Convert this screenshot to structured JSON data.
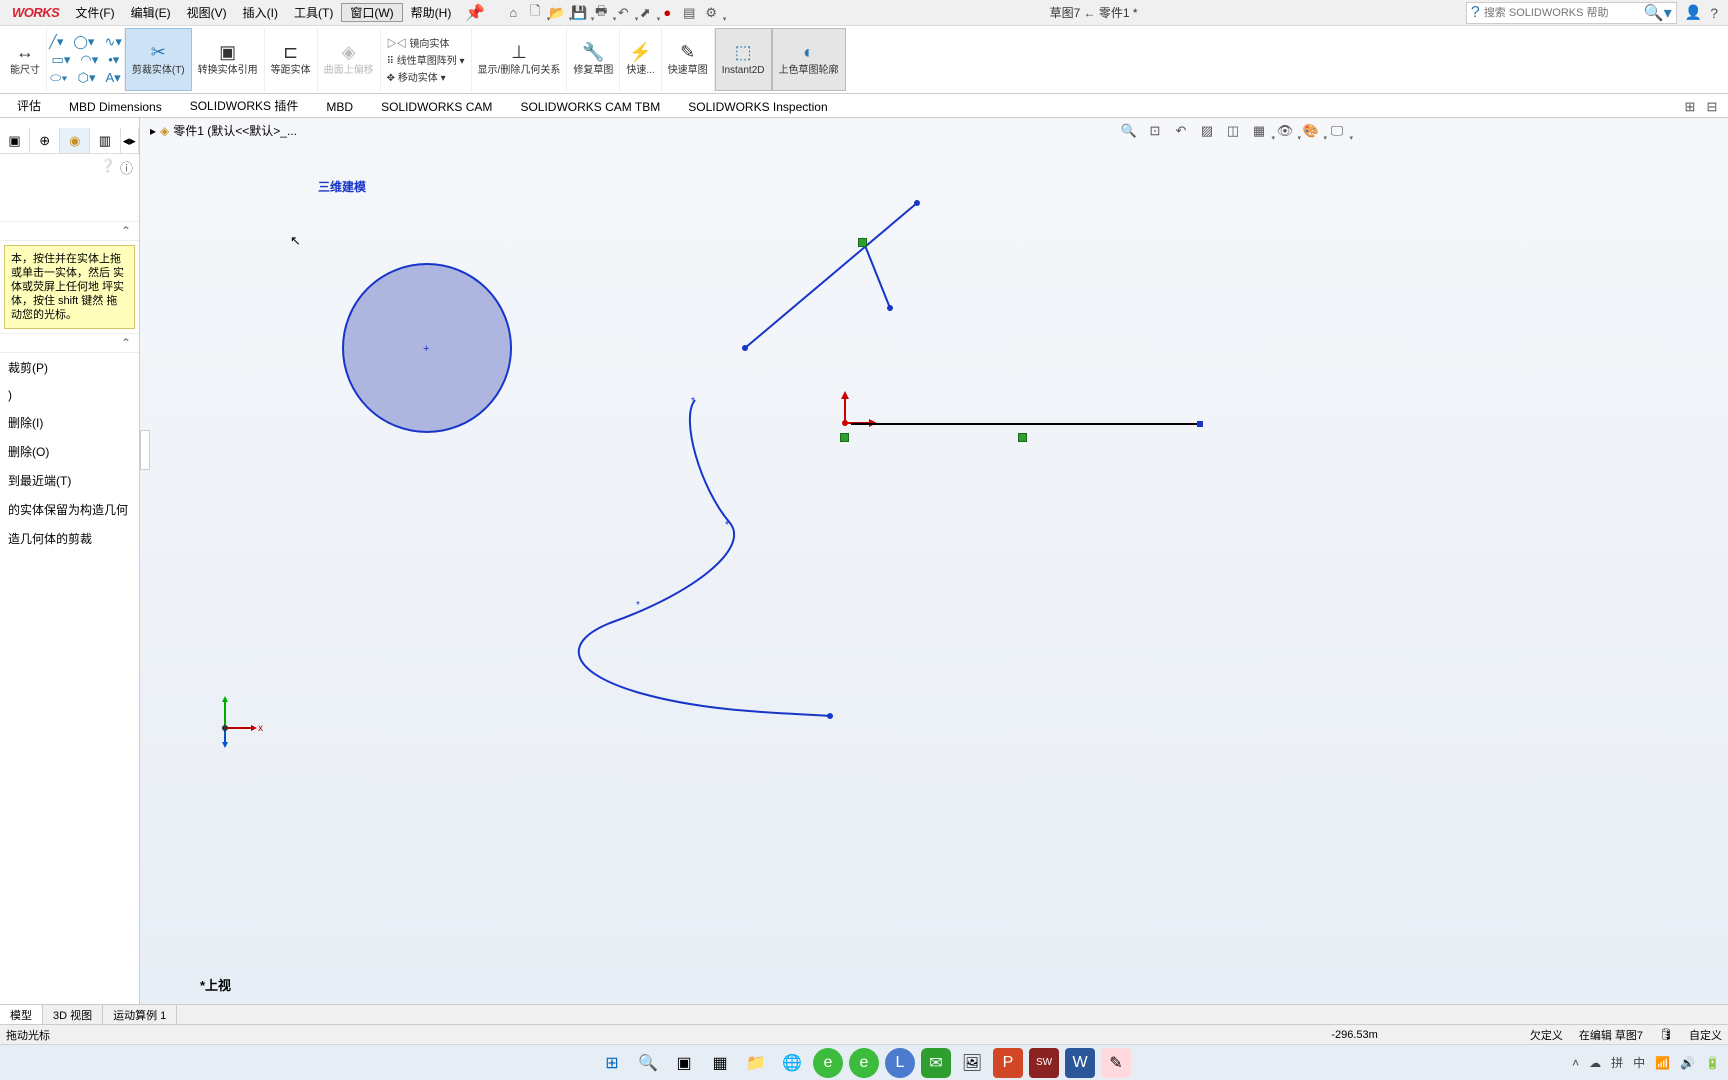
{
  "app": {
    "logo": "WORKS"
  },
  "menu": {
    "file": "文件(F)",
    "edit": "编辑(E)",
    "view": "视图(V)",
    "insert": "插入(I)",
    "tools": "工具(T)",
    "window": "窗口(W)",
    "help": "帮助(H)"
  },
  "doc_title": "草图7 ← 零件1 *",
  "search": {
    "placeholder": "搜索 SOLIDWORKS 帮助"
  },
  "ribbon": {
    "smart_dim": "能尺寸",
    "trim": "剪裁实体(T)",
    "convert": "转换实体引用",
    "offset": "等距实体",
    "surface_offset": "曲面上偏移",
    "mirror": "镜向实体",
    "pattern": "线性草图阵列",
    "move": "移动实体",
    "relations": "显示/删除几何关系",
    "repair": "修复草图",
    "quick": "快速...",
    "rapid": "快速草图",
    "instant": "Instant2D",
    "shade": "上色草图轮廓"
  },
  "tabs": [
    "评估",
    "MBD Dimensions",
    "SOLIDWORKS 插件",
    "MBD",
    "SOLIDWORKS CAM",
    "SOLIDWORKS CAM TBM",
    "SOLIDWORKS Inspection"
  ],
  "breadcrumb": "零件1 (默认<<默认>_...",
  "hint": "本，按住并在实体上拖 或单击一实体，然后 实体或荧屏上任何地 坪实体，按住 shift 键然 拖动您的光标。",
  "side_items": {
    "trim_p": "裁剪(P)",
    "remove_i": "删除(I)",
    "remove_o": "删除(O)",
    "nearest": "到最近端(T)",
    "keep_construct": "的实体保留为构造几何",
    "construct_trim": "造几何体的剪裁"
  },
  "watermark": "三维建模",
  "axis_label": "*上视",
  "view_tabs": [
    "模型",
    "3D 视图",
    "运动算例 1"
  ],
  "status": {
    "left": "拖动光标",
    "coord": "-296.53m",
    "under": "欠定义",
    "editing": "在编辑 草图7",
    "custom": "自定义"
  },
  "tray": {
    "ime1": "拼",
    "ime2": "中"
  }
}
